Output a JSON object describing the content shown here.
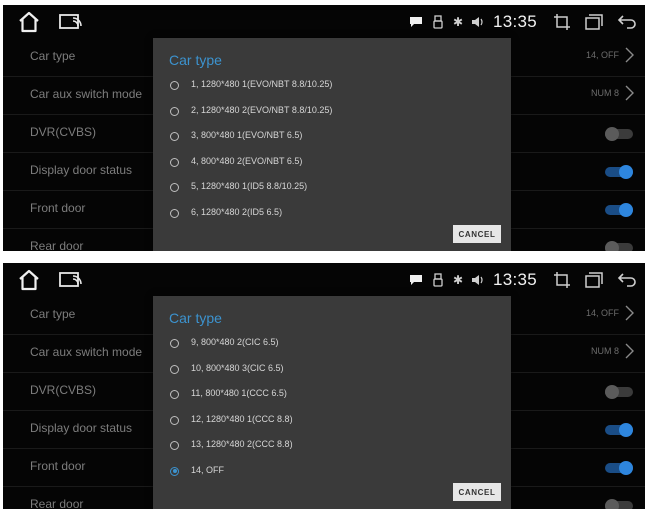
{
  "screens": [
    {
      "status": {
        "time": "13:35"
      },
      "settings": [
        {
          "label": "Car type",
          "value": "14, OFF"
        },
        {
          "label": "Car aux switch mode",
          "value": "NUM 8"
        },
        {
          "label": "DVR(CVBS)"
        },
        {
          "label": "Display door status"
        },
        {
          "label": "Front door"
        },
        {
          "label": "Rear door"
        }
      ],
      "toggles": {
        "dvr": false,
        "display_door_status": true,
        "front_door": true,
        "rear_door": false
      },
      "dialog": {
        "title": "Car type",
        "options": [
          "1, 1280*480 1(EVO/NBT 8.8/10.25)",
          "2, 1280*480 2(EVO/NBT 8.8/10.25)",
          "3, 800*480 1(EVO/NBT 6.5)",
          "4, 800*480 2(EVO/NBT 6.5)",
          "5, 1280*480 1(ID5 8.8/10.25)",
          "6, 1280*480 2(ID5 6.5)"
        ],
        "selected_index": null,
        "cancel_label": "CANCEL"
      }
    },
    {
      "status": {
        "time": "13:35"
      },
      "settings": [
        {
          "label": "Car type",
          "value": "14, OFF"
        },
        {
          "label": "Car aux switch mode",
          "value": "NUM 8"
        },
        {
          "label": "DVR(CVBS)"
        },
        {
          "label": "Display door status"
        },
        {
          "label": "Front door"
        },
        {
          "label": "Rear door"
        }
      ],
      "toggles": {
        "dvr": false,
        "display_door_status": true,
        "front_door": true,
        "rear_door": false
      },
      "dialog": {
        "title": "Car type",
        "options": [
          "9, 800*480 2(CIC 6.5)",
          "10, 800*480 3(CIC 6.5)",
          "11, 800*480 1(CCC 6.5)",
          "12, 1280*480 1(CCC 8.8)",
          "13, 1280*480 2(CCC 8.8)",
          "14, OFF"
        ],
        "selected_index": 5,
        "cancel_label": "CANCEL"
      }
    }
  ],
  "colors": {
    "accent": "#3c93cf",
    "toggle_on": "#2e86de",
    "background": "#050505",
    "dialog": "#3a3a3a"
  },
  "icons": [
    "home-icon",
    "cast-icon",
    "message-icon",
    "usb-icon",
    "bluetooth-icon",
    "volume-icon",
    "screenshot-icon",
    "window-icon",
    "back-icon",
    "chevron-right-icon"
  ]
}
